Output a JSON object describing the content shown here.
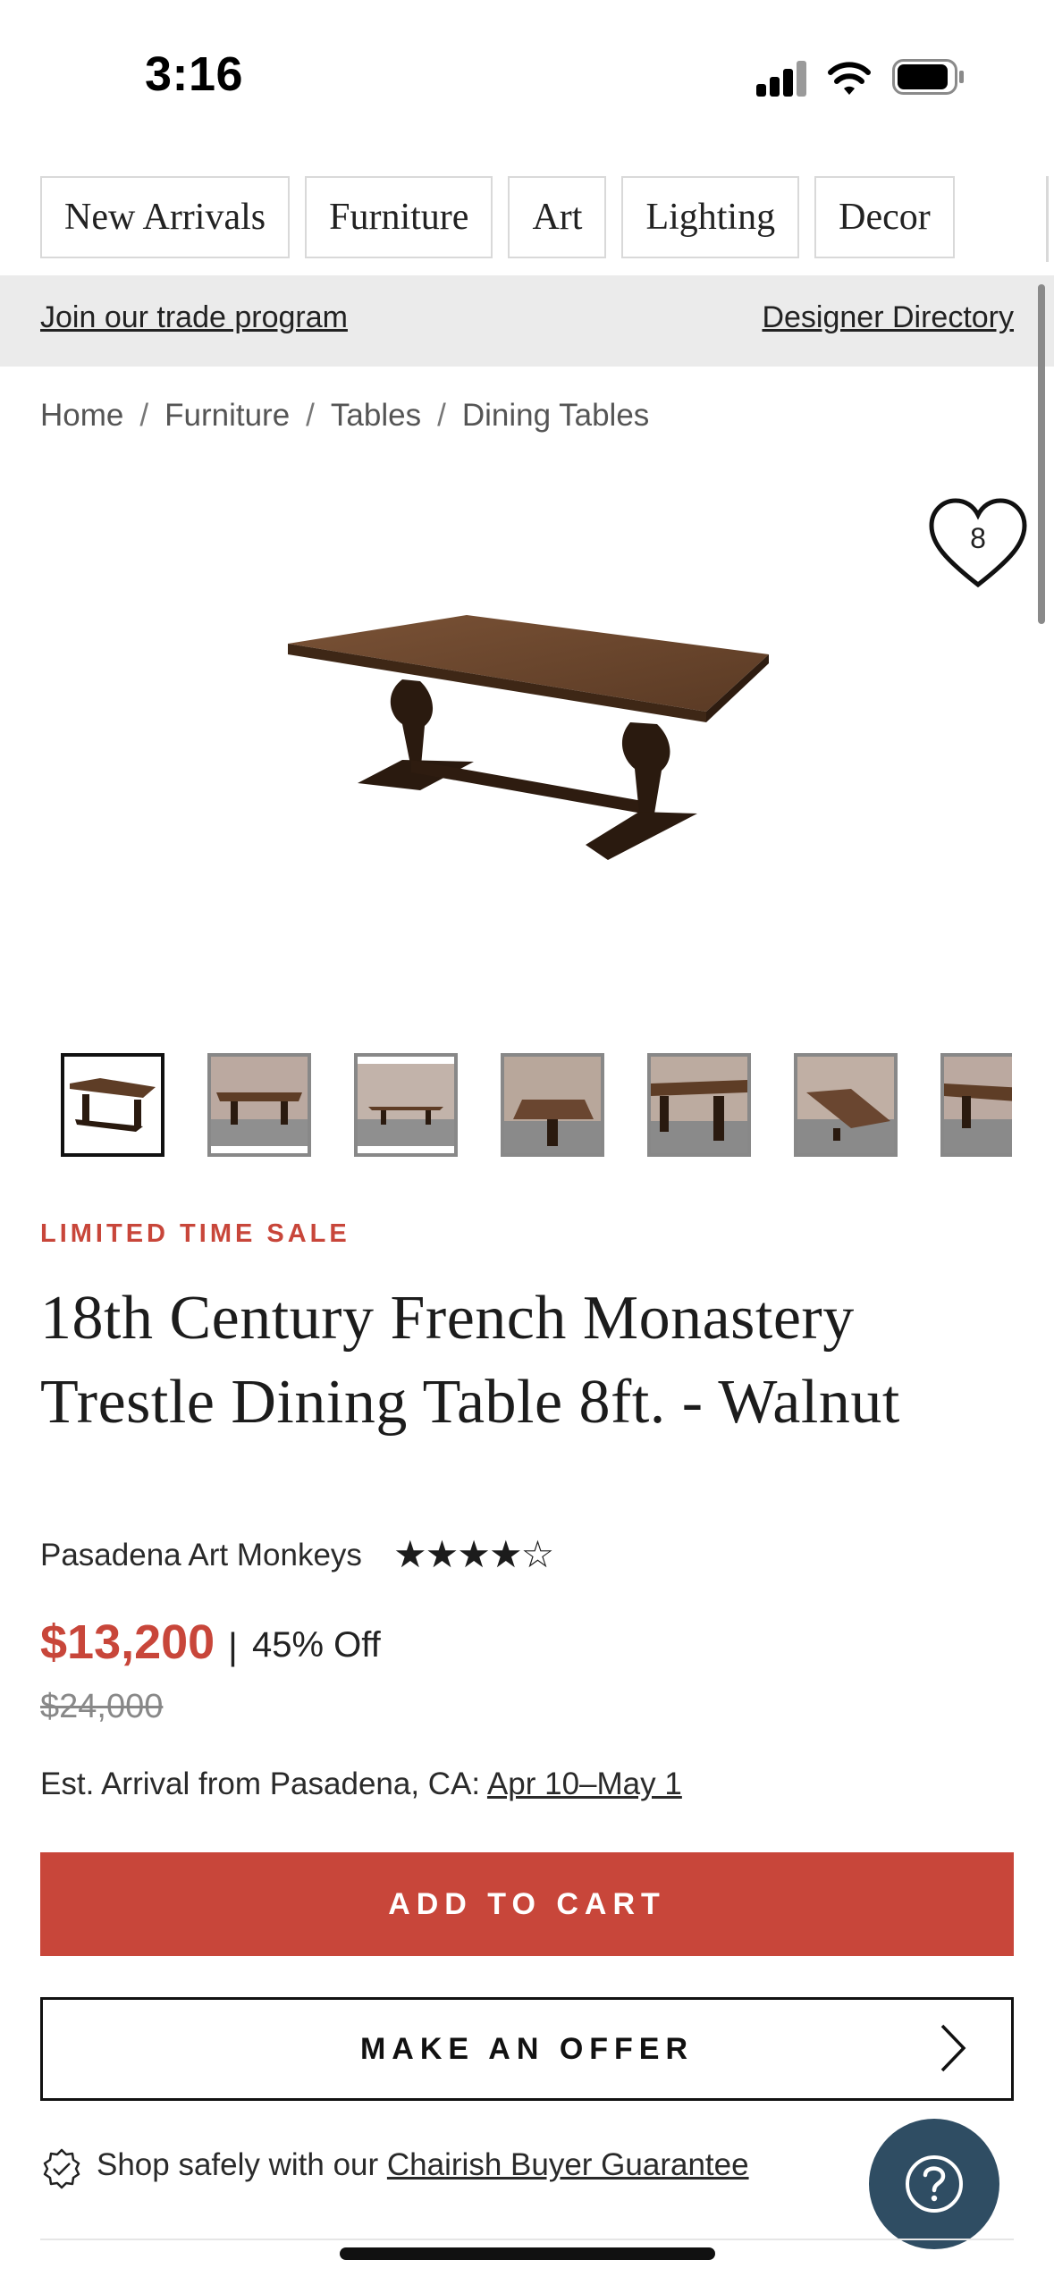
{
  "status_bar": {
    "time": "3:16"
  },
  "nav": {
    "items": [
      {
        "label": "New Arrivals"
      },
      {
        "label": "Furniture"
      },
      {
        "label": "Art"
      },
      {
        "label": "Lighting"
      },
      {
        "label": "Decor"
      }
    ]
  },
  "trade_banner": {
    "left_link": "Join our trade program",
    "right_link": "Designer Directory"
  },
  "breadcrumb": {
    "items": [
      "Home",
      "Furniture",
      "Tables",
      "Dining Tables"
    ],
    "separator": "/"
  },
  "favorite": {
    "count": "8"
  },
  "product": {
    "sale_label": "LIMITED TIME SALE",
    "title": "18th Century French Monastery Trestle Dining Table 8ft. - Walnut",
    "seller": "Pasadena Art Monkeys",
    "rating": 4,
    "rating_max": 5,
    "stars": "★★★★☆",
    "price": "$13,200",
    "price_separator": "|",
    "discount": "45% Off",
    "original_price": "$24,000",
    "arrival_prefix": "Est. Arrival from Pasadena, CA:",
    "arrival_dates": "Apr 10–May 1"
  },
  "actions": {
    "add_to_cart": "ADD TO CART",
    "make_offer": "MAKE AN OFFER"
  },
  "guarantee": {
    "prefix": "Shop safely with our",
    "link": "Chairish Buyer Guarantee"
  },
  "help": {
    "icon": "question-icon"
  },
  "colors": {
    "accent": "#c8463a",
    "help_button": "#2f4d63",
    "banner_bg": "#ebebeb"
  }
}
